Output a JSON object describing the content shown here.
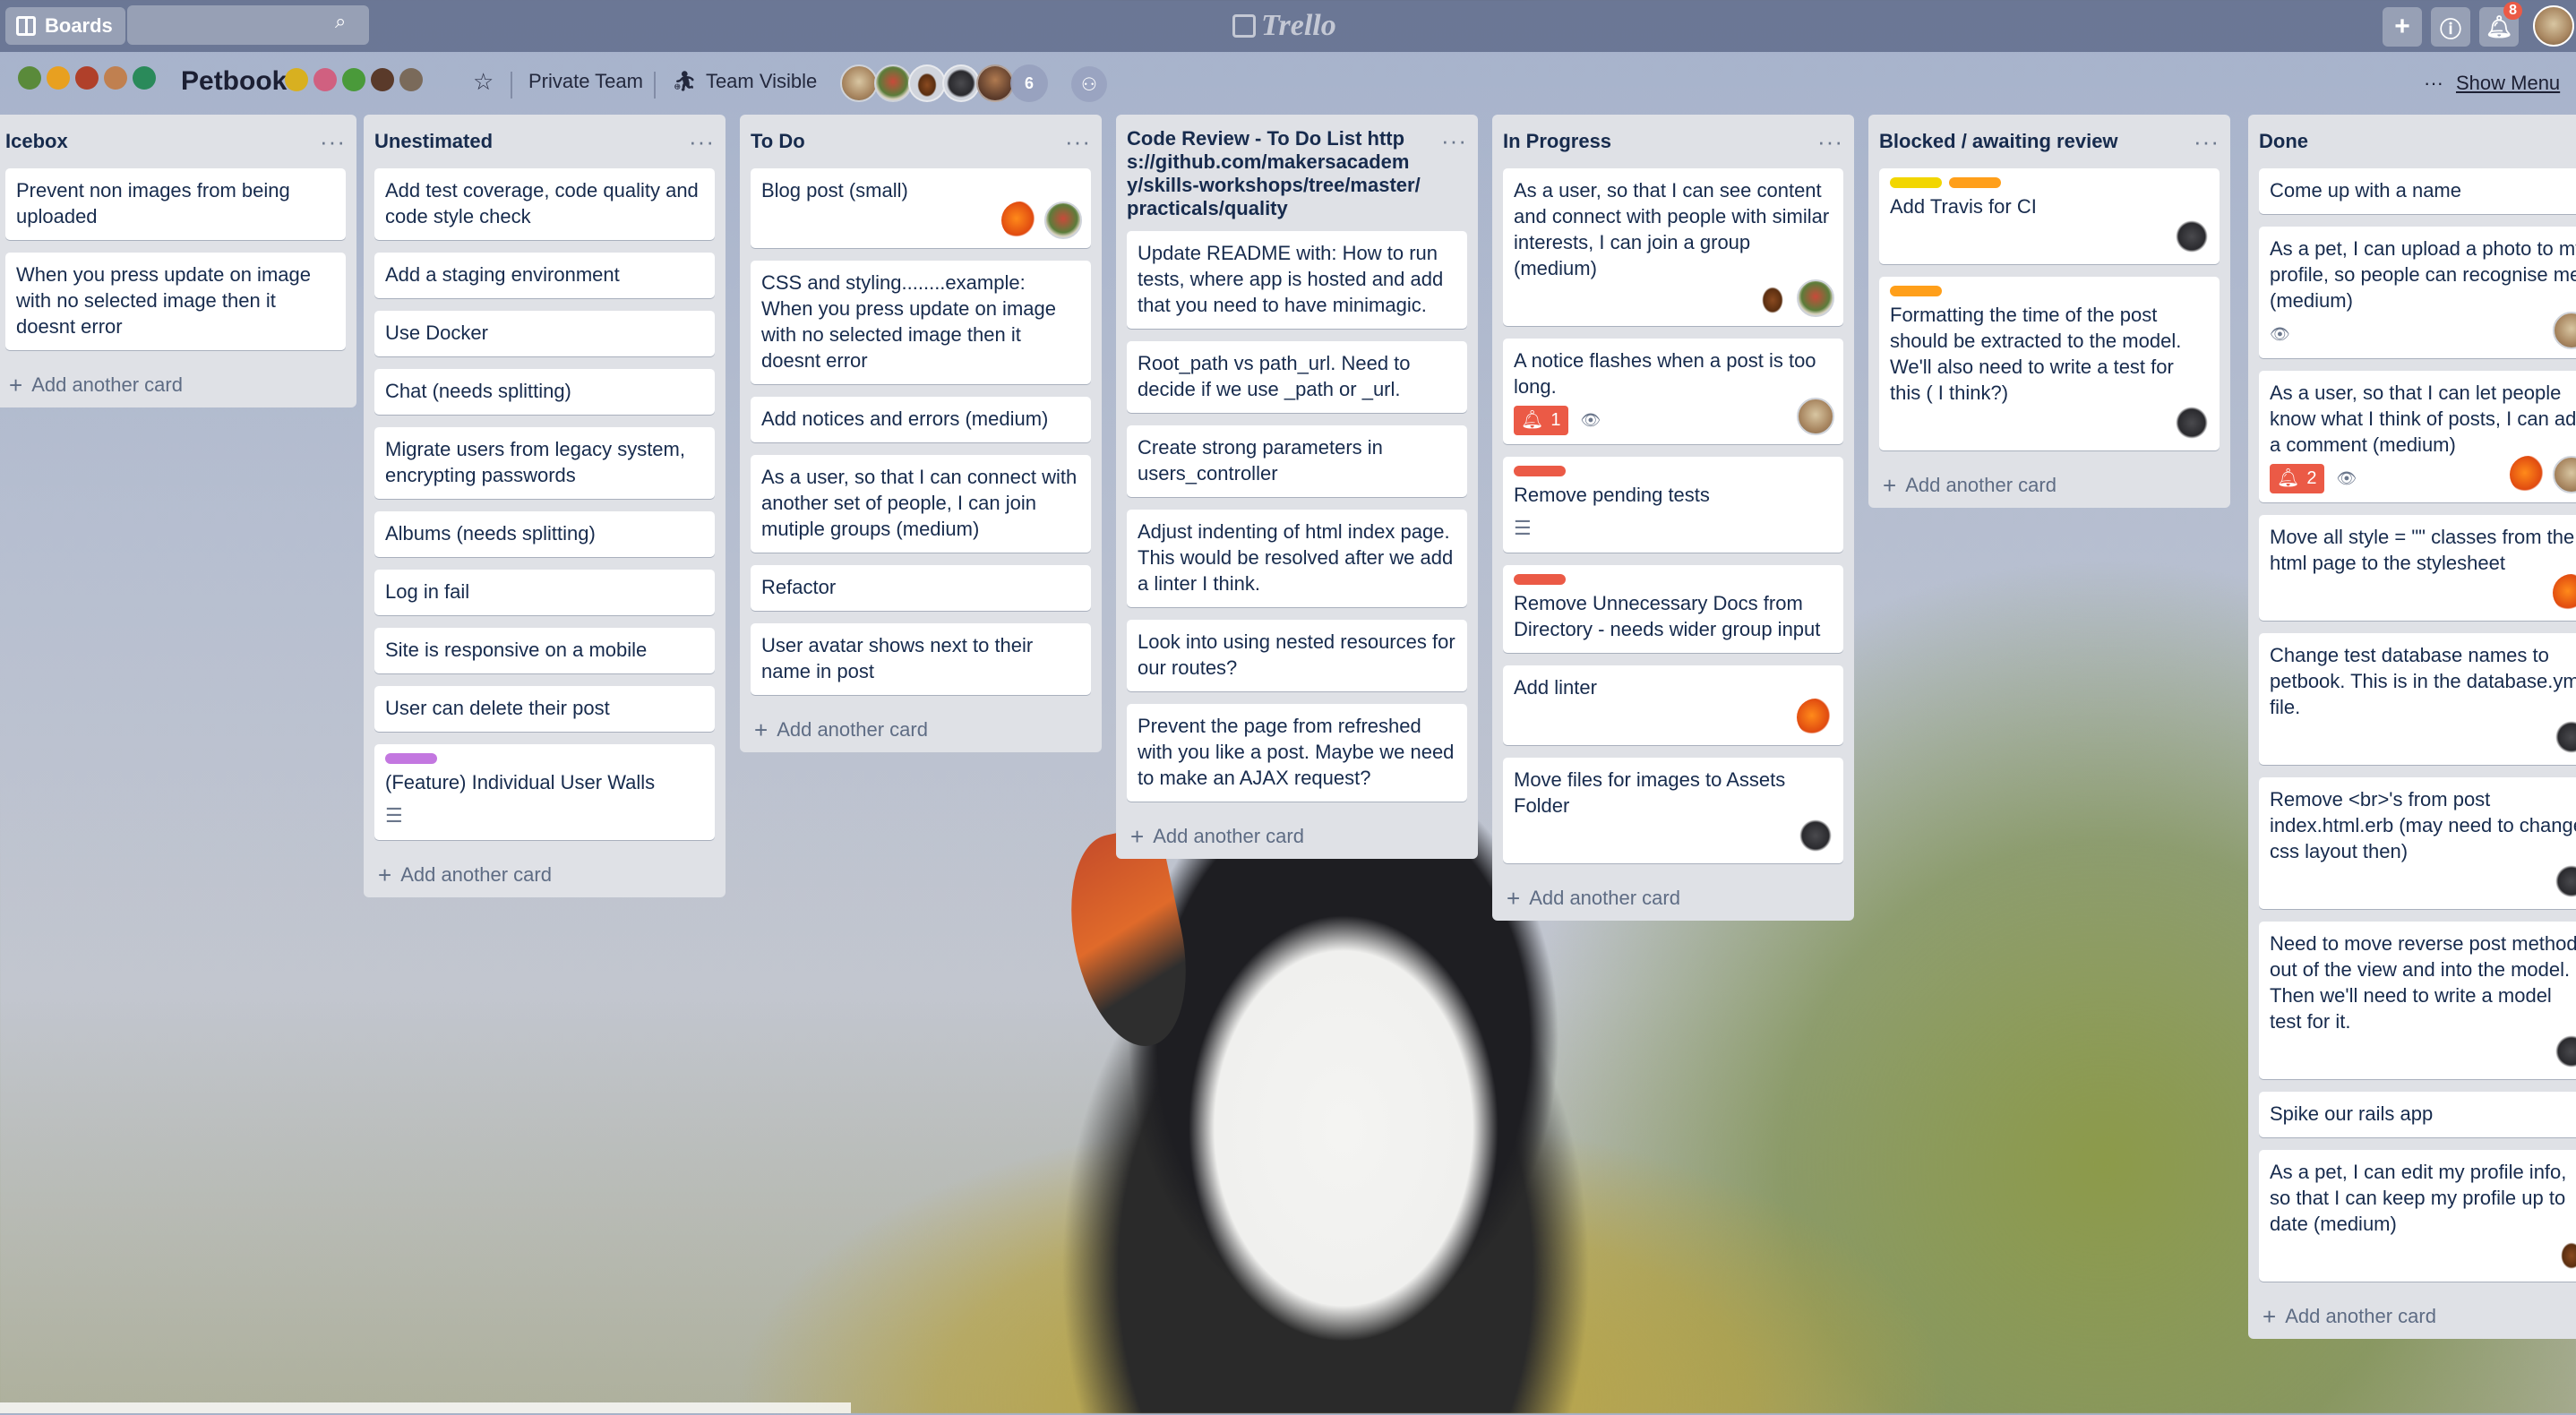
{
  "header": {
    "boards_label": "Boards",
    "search_placeholder": "",
    "logo_text": "Trello",
    "notification_count": "8"
  },
  "board": {
    "title": "Petbook",
    "privacy_label": "Private Team",
    "visibility_label": "Team Visible",
    "member_overflow": "6",
    "show_menu_label": "Show Menu"
  },
  "add_card_label": "Add another card",
  "lists": [
    {
      "title": "Icebox",
      "cards": [
        {
          "text": "Prevent non images from being uploaded"
        },
        {
          "text": "When you press update on image with no selected image then it doesnt error"
        }
      ]
    },
    {
      "title": "Unestimated",
      "cards": [
        {
          "text": "Add test coverage, code quality and code style check"
        },
        {
          "text": "Add a staging environment"
        },
        {
          "text": "Use Docker"
        },
        {
          "text": "Chat (needs splitting)"
        },
        {
          "text": "Migrate users from legacy system, encrypting passwords"
        },
        {
          "text": "Albums (needs splitting)"
        },
        {
          "text": "Log in fail"
        },
        {
          "text": "Site is responsive on a mobile"
        },
        {
          "text": "User can delete their post"
        },
        {
          "text": "(Feature) Individual User Walls",
          "label_colors": [
            "#c377e0"
          ],
          "has_description": true
        }
      ]
    },
    {
      "title": "To Do",
      "cards": [
        {
          "text": "Blog post (small)",
          "avatars": [
            "fish",
            "bird"
          ]
        },
        {
          "text": "CSS and styling........example: When you press update on image with no selected image then it doesnt error"
        },
        {
          "text": "Add notices and errors (medium)"
        },
        {
          "text": "As a user, so that I can connect with another set of people, I can join mutiple groups (medium)"
        },
        {
          "text": "Refactor"
        },
        {
          "text": "User avatar shows next to their name in post"
        }
      ]
    },
    {
      "title": "Code Review - To Do List https://github.com/makersacademy/skills-workshops/tree/master/practicals/quality",
      "cards": [
        {
          "text": "Update README with: How to run tests, where app is hosted and add that you need to have minimagic."
        },
        {
          "text": "Root_path vs path_url. Need to decide if we use _path or _url."
        },
        {
          "text": "Create strong parameters in users_controller"
        },
        {
          "text": "Adjust indenting of html index page. This would be resolved after we add a linter I think."
        },
        {
          "text": "Look into using nested resources for our routes?"
        },
        {
          "text": "Prevent the page from refreshed with you like a post. Maybe we need to make an AJAX request?"
        }
      ]
    },
    {
      "title": "In Progress",
      "cards": [
        {
          "text": "As a user, so that I can see content and connect with people with similar interests, I can join a group (medium)",
          "avatars": [
            "beaver",
            "bird"
          ]
        },
        {
          "text": "A notice flashes when a post is too long.",
          "due": "1",
          "watching": true,
          "avatars": [
            "cat"
          ]
        },
        {
          "text": "Remove pending tests",
          "label_colors": [
            "#eb5a46"
          ],
          "has_description": true
        },
        {
          "text": "Remove Unnecessary Docs from Directory - needs wider group input",
          "label_colors": [
            "#eb5a46"
          ]
        },
        {
          "text": "Add linter",
          "avatars": [
            "fish"
          ]
        },
        {
          "text": "Move files for images to Assets Folder",
          "avatars": [
            "monkey"
          ]
        }
      ]
    },
    {
      "title": "Blocked / awaiting review",
      "cards": [
        {
          "text": "Add Travis for CI",
          "label_colors": [
            "#f2d600",
            "#ff9f1a"
          ],
          "avatars": [
            "monkey"
          ]
        },
        {
          "text": "Formatting the time of the post should be extracted to the model. We'll also need to write a test for this ( I think?)",
          "label_colors": [
            "#ff9f1a"
          ],
          "avatars": [
            "monkey"
          ]
        }
      ]
    },
    {
      "title": "Done",
      "cards": [
        {
          "text": "Come up with a name"
        },
        {
          "text": "As a pet, I can upload a photo to my profile, so people can recognise me (medium)",
          "watching": true,
          "avatars": [
            "cat"
          ]
        },
        {
          "text": "As a user, so that I can let people know what I think of posts, I can add a comment (medium)",
          "due": "2",
          "watching": true,
          "avatars": [
            "fish",
            "cat"
          ]
        },
        {
          "text": "Move all style = \"\" classes from the html page to the stylesheet",
          "avatars": [
            "fish"
          ]
        },
        {
          "text": "Change test database names to petbook. This is in the database.yml file.",
          "avatars": [
            "monkey"
          ]
        },
        {
          "text": "Remove <br>'s from post index.html.erb (may need to change css layout then)",
          "avatars": [
            "monkey"
          ]
        },
        {
          "text": "Need to move reverse post method out of the view and into the model. Then we'll need to write a model test for it.",
          "avatars": [
            "monkey"
          ]
        },
        {
          "text": "Spike our rails app"
        },
        {
          "text": "As a pet, I can edit my profile info, so that I can keep my profile up to date (medium)",
          "avatars": [
            "beaver"
          ]
        }
      ]
    }
  ]
}
